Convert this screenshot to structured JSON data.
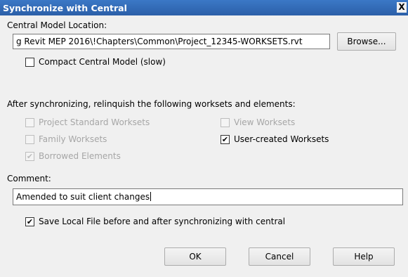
{
  "window": {
    "title": "Synchronize with Central",
    "close_glyph": "X"
  },
  "central": {
    "label": "Central Model Location:",
    "path_value": "g Revit MEP 2016\\!Chapters\\Common\\Project_12345-WORKSETS.rvt",
    "browse_label": "Browse..."
  },
  "compact": {
    "label": "Compact Central Model (slow)",
    "checked": false
  },
  "relinquish": {
    "heading": "After synchronizing, relinquish the following worksets and elements:",
    "options": {
      "project_standard": {
        "label": "Project Standard Worksets",
        "checked": false,
        "enabled": false
      },
      "family": {
        "label": "Family Worksets",
        "checked": false,
        "enabled": false
      },
      "borrowed": {
        "label": "Borrowed Elements",
        "checked": true,
        "enabled": false
      },
      "view": {
        "label": "View Worksets",
        "checked": false,
        "enabled": false
      },
      "user_created": {
        "label": "User-created Worksets",
        "checked": true,
        "enabled": true
      }
    }
  },
  "comment": {
    "label": "Comment:",
    "value": "Amended to suit client changes"
  },
  "save_local": {
    "label": "Save Local File before and after synchronizing with central",
    "checked": true
  },
  "buttons": {
    "ok": "OK",
    "cancel": "Cancel",
    "help": "Help"
  },
  "check_glyph": "✔"
}
